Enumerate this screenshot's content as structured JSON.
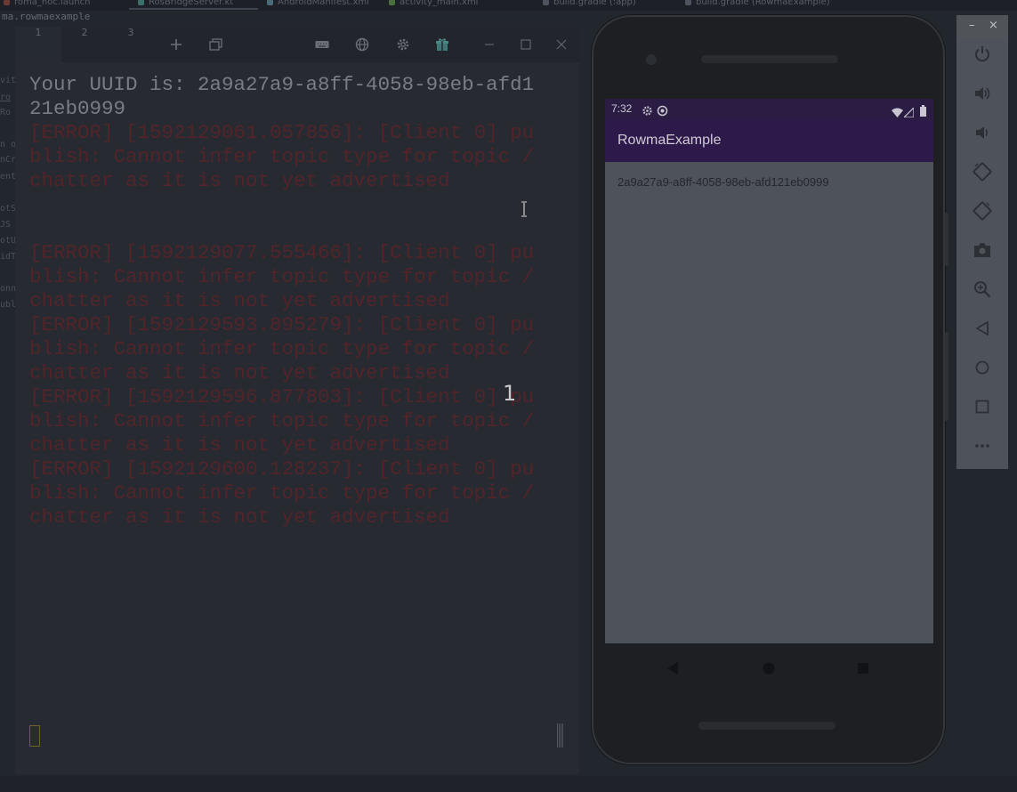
{
  "ide": {
    "tabs": [
      "roma_noc.launch",
      "RosBridgeServer.kt",
      "AndroidManifest.xml",
      "activity_main.xml",
      "build.gradle (:app)",
      "build.gradle (RowmaExample)"
    ],
    "breadcrumb": "ma.rowmaexample",
    "gutter_fragments": [
      "vit",
      "ro",
      "Ro",
      "n o",
      "nCr",
      "ent",
      "otS",
      "JS",
      "otU",
      "idT",
      "onn",
      "ubl"
    ]
  },
  "terminal": {
    "tabs": [
      "1",
      "2",
      "3"
    ],
    "active_tab": "1",
    "icons": [
      "new-tab-icon",
      "split-pane-icon",
      "keyboard-icon",
      "globe-icon",
      "settings-icon",
      "gift-icon",
      "minimize-icon",
      "maximize-icon",
      "close-icon"
    ],
    "output": {
      "uuid_l1": "Your UUID is: 2a9a27a9-a8ff-4058-98eb-afd1",
      "uuid_l2": "21eb0999",
      "e1_l1": "[ERROR] [1592129061.057856]: [Client 0] pu",
      "e1_l2": "blish: Cannot infer topic type for topic /",
      "e1_l3": "chatter as it is not yet advertised",
      "e2_l1": "[ERROR] [1592129077.555466]: [Client 0] pu",
      "e2_l2": "blish: Cannot infer topic type for topic /",
      "e2_l3": "chatter as it is not yet advertised",
      "e3_l1": "[ERROR] [1592129593.895279]: [Client 0] pu",
      "e3_l2": "blish: Cannot infer topic type for topic /",
      "e3_l3": "chatter as it is not yet advertised",
      "e4_l1": "[ERROR] [1592129596.877803]: [Client 0] pu",
      "e4_l2": "blish: Cannot infer topic type for topic /",
      "e4_l3": "chatter as it is not yet advertised",
      "e5_l1": "[ERROR] [1592129600.128237]: [Client 0] pu",
      "e5_l2": "blish: Cannot infer topic type for topic /",
      "e5_l3": "chatter as it is not yet advertised"
    },
    "overlay_count": "1"
  },
  "phone": {
    "status_time": "7:32",
    "status_icons": [
      "settings-icon",
      "sync-icon",
      "wifi-icon",
      "signal-icon",
      "battery-icon"
    ],
    "app_title": "RowmaExample",
    "uuid_text": "2a9a27a9-a8ff-4058-98eb-afd121eb0999",
    "nav": [
      "back-icon",
      "home-icon",
      "recents-icon"
    ]
  },
  "emulator_toolbar": {
    "header": [
      "minimize",
      "close"
    ],
    "header_glyphs": [
      "–",
      "×"
    ],
    "buttons": [
      "power-icon",
      "volume-up-icon",
      "volume-down-icon",
      "rotate-left-icon",
      "rotate-right-icon",
      "camera-icon",
      "zoom-icon",
      "back-icon",
      "home-icon",
      "overview-icon",
      "more-icon"
    ]
  },
  "colors": {
    "error_text": "#522429",
    "uuid_text": "#787c84",
    "app_bar": "#2d1a4a",
    "screen_bg": "#4e525b"
  }
}
